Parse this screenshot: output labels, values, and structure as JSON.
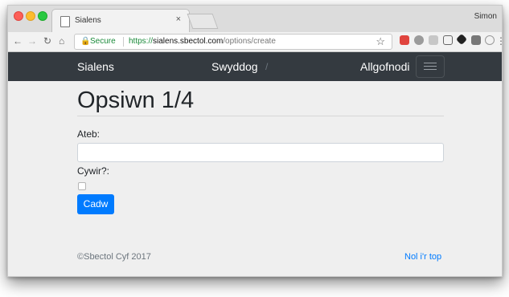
{
  "browser": {
    "tab_title": "Sialens",
    "tab_close": "×",
    "profile_name": "Simon",
    "secure_label": "Secure",
    "url_scheme": "https://",
    "url_host": "sialens.sbectol.com",
    "url_path": "/options/create"
  },
  "navbar": {
    "brand": "Sialens",
    "item_swyddog": "Swyddog",
    "separator": "/",
    "item_logout": "Allgofnodi"
  },
  "form": {
    "heading": "Opsiwn 1/4",
    "answer_label": "Ateb:",
    "answer_value": "",
    "correct_label": "Cywir?:",
    "correct_checked": false,
    "save_button": "Cadw"
  },
  "footer": {
    "copyright": "©Sbectol Cyf 2017",
    "back_to_top": "Nol i'r top"
  },
  "colors": {
    "navbar": "#343a40",
    "primary": "#007bff",
    "page_bg": "#efefef"
  },
  "icons": [
    "back-icon",
    "forward-icon",
    "reload-icon",
    "home-icon",
    "lock-icon",
    "star-icon",
    "menu-icon"
  ]
}
